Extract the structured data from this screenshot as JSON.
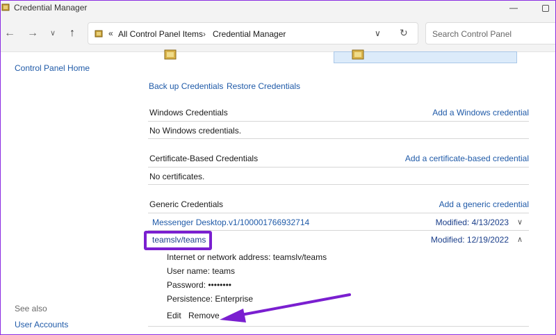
{
  "window": {
    "title": "Credential Manager",
    "minimize": "—"
  },
  "nav": {
    "address_items": [
      "All Control Panel Items",
      "Credential Manager"
    ],
    "address_chevrons": "«",
    "search_placeholder": "Search Control Panel"
  },
  "sidebar": {
    "home_link": "Control Panel Home",
    "see_also": "See also",
    "see_also_links": [
      "User Accounts"
    ]
  },
  "actions": {
    "backup": "Back up Credentials",
    "restore": "Restore Credentials"
  },
  "sections": [
    {
      "title": "Windows Credentials",
      "add_link": "Add a Windows credential",
      "empty_text": "No Windows credentials."
    },
    {
      "title": "Certificate-Based Credentials",
      "add_link": "Add a certificate-based credential",
      "empty_text": "No certificates."
    },
    {
      "title": "Generic Credentials",
      "add_link": "Add a generic credential"
    }
  ],
  "generic_credentials": [
    {
      "name": "Messenger Desktop.v1/100001766932714",
      "modified": "Modified:  4/13/2023"
    },
    {
      "name": "teamslv/teams",
      "modified": "Modified:  12/19/2022",
      "details": [
        "Internet or network address:  teamslv/teams",
        "User name:  teams",
        "Password:  ••••••••",
        "Persistence:  Enterprise"
      ],
      "edit": "Edit",
      "remove": "Remove"
    }
  ],
  "colors": {
    "link": "#1f5aa8",
    "highlight": "#7a1fd0",
    "chrome": "#f3f3f3"
  },
  "icons": [
    "credential-manager-icon",
    "back-arrow-icon",
    "forward-arrow-icon",
    "recent-chevron-icon",
    "up-arrow-icon",
    "refresh-icon",
    "vault-icon",
    "chevron-down-icon",
    "chevron-up-icon",
    "annotation-arrow-icon"
  ]
}
